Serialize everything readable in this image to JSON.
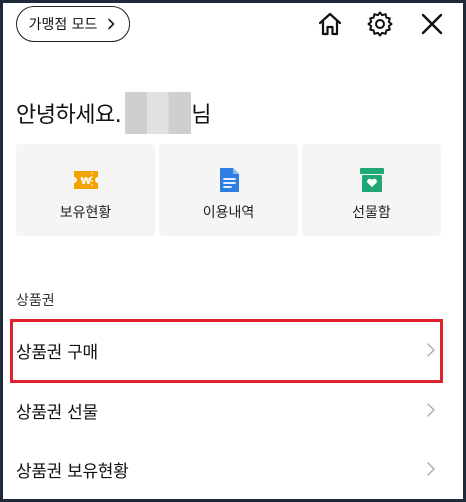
{
  "header": {
    "merchant_mode_label": "가맹점 모드",
    "icons": [
      "home-icon",
      "gear-icon",
      "close-icon"
    ]
  },
  "greeting": {
    "prefix": "안녕하세요.",
    "suffix": "님"
  },
  "cards": [
    {
      "label": "보유현황",
      "icon": "ticket-won-icon",
      "color": "#f5a300"
    },
    {
      "label": "이용내역",
      "icon": "document-icon",
      "color": "#2f7de1"
    },
    {
      "label": "선물함",
      "icon": "gift-box-icon",
      "color": "#1fa774"
    }
  ],
  "section": {
    "title": "상품권",
    "items": [
      {
        "label": "상품권 구매"
      },
      {
        "label": "상품권 선물"
      },
      {
        "label": "상품권 보유현황"
      }
    ]
  },
  "colors": {
    "highlight": "#e0202a",
    "frame": "#1c2a3a"
  }
}
